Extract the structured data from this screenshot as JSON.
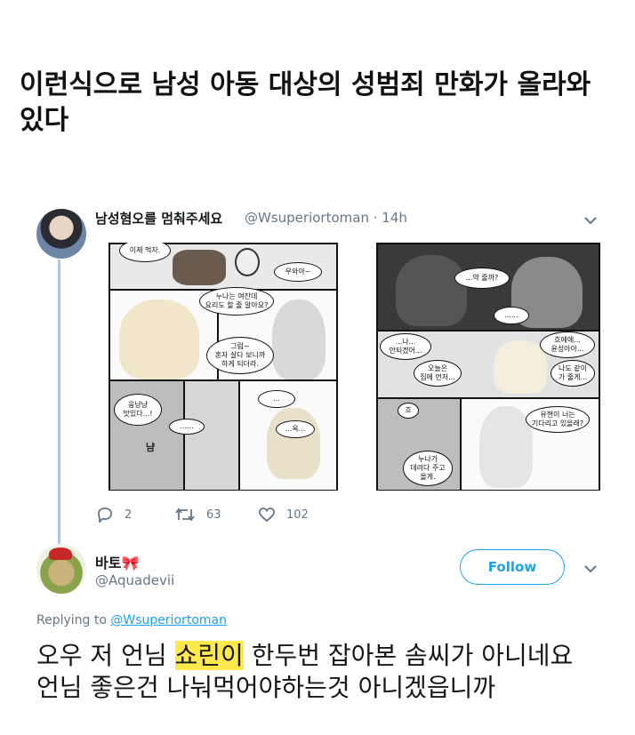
{
  "headline": "이런식으로 남성 아동 대상의 성범죄 만화가 올라와 있다",
  "tweet1": {
    "author_name": "남성혐오를 멈춰주세요",
    "author_handle": "@Wsuperiortoman · 14h",
    "avatar_icon": "profile-photo",
    "comic_left": {
      "bubbles": [
        "이제 먹자.",
        "우와아~",
        "누나는 여잔데\n요리도 할 줄 알아요?",
        "그럼~\n혼자 살다 보니까\n하게 되더라.",
        "...",
        "웅냥냥\n맛있다...!",
        "......",
        "...옥..."
      ],
      "sfx": "냠"
    },
    "comic_right": {
      "bubbles": [
        "...약 줄까?",
        "......",
        "...나...\n안되겠어...",
        "오늘은\n집에 먼저...",
        "흐에에...\n윤성아아...",
        "나도 같이\n가 줄게...",
        "흐",
        "유현이 너는\n기다리고 있을래?",
        "누나가\n데려다 주고\n올게."
      ]
    },
    "actions": {
      "replies": "2",
      "retweets": "63",
      "likes": "102"
    }
  },
  "tweet2": {
    "author_name": "바토🎀",
    "author_handle": "@Aquadevii",
    "follow_label": "Follow",
    "replying_prefix": "Replying to",
    "replying_handle": "@Wsuperiortoman",
    "text_part1": "오우 저 언님 ",
    "text_highlight": "쇼린이",
    "text_part2": " 한두번 잡아본 솜씨가 아니네요",
    "text_line2": "언님 좋은건 나눠먹어야하는것 아니겠읍니까"
  },
  "colors": {
    "accent": "#1da1f2",
    "muted": "#657786",
    "highlight": "#ffe94d",
    "thread_line": "#9ecdf2"
  }
}
